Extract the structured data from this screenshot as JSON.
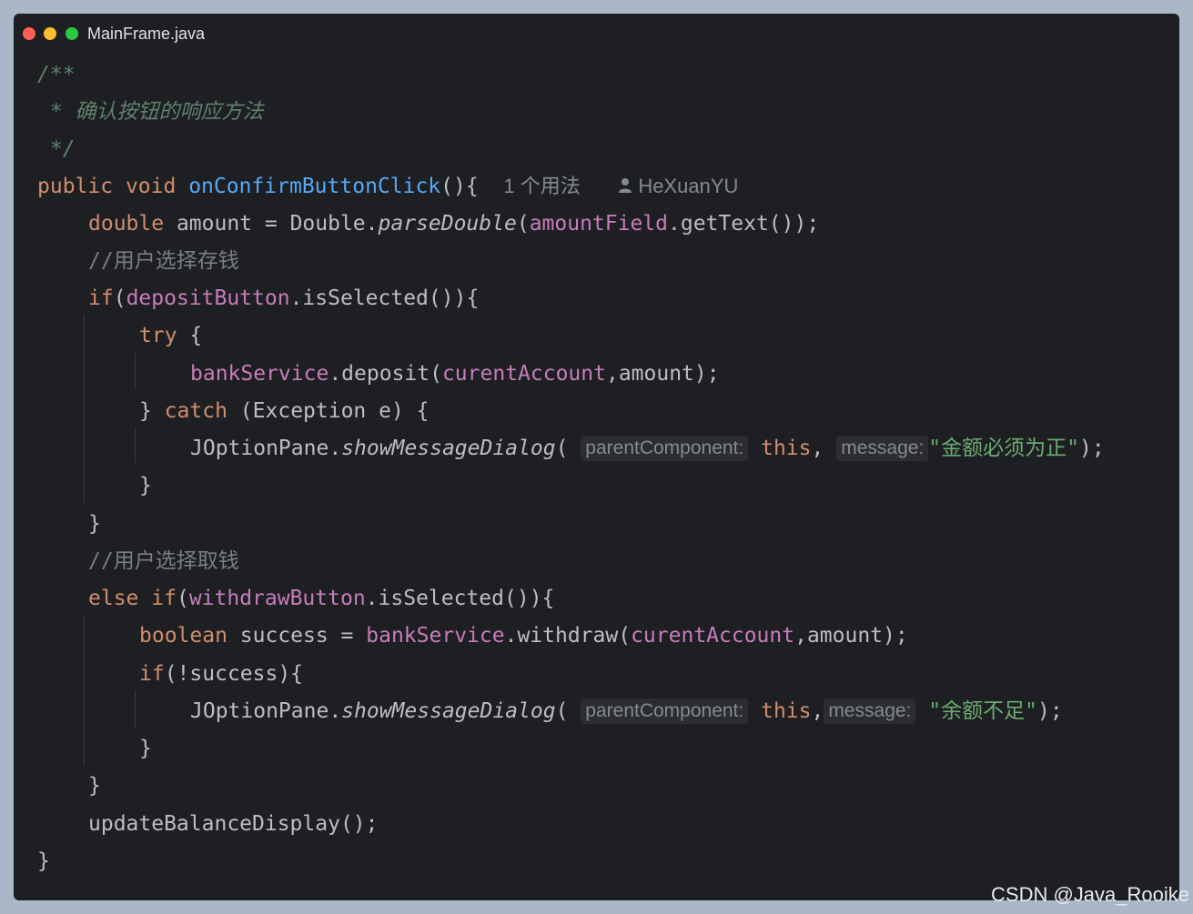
{
  "window": {
    "filename": "MainFrame.java"
  },
  "code": {
    "doc_open": "/**",
    "doc_line": " * 确认按钮的响应方法",
    "doc_close": " */",
    "m_public": "public",
    "m_void": "void",
    "m_name": "onConfirmButtonClick",
    "m_parens": "(){",
    "m_usages": "1 个用法",
    "m_author": "HeXuanYU",
    "l2_type": "double",
    "l2_var": " amount = Double.",
    "l2_call": "parseDouble",
    "l2_paren": "(",
    "l2_field": "amountField",
    "l2_rest": ".getText());",
    "c1": "//用户选择存钱",
    "l4_if": "if",
    "l4_paren": "(",
    "l4_field": "depositButton",
    "l4_rest": ".isSelected()){",
    "l5_try": "try",
    "l5_rest": " {",
    "l6_field": "bankService",
    "l6_call": ".deposit(",
    "l6_field2": "curentAccount",
    "l6_rest": ",amount);",
    "l7_open": "} ",
    "l7_catch": "catch",
    "l7_rest": " (Exception e) {",
    "l8_cls": "JOptionPane.",
    "l8_call": "showMessageDialog",
    "l8_paren": "(",
    "l8_hint1": "parentComponent:",
    "l8_this": "this",
    "l8_comma": ",",
    "l8_hint2": "message:",
    "l8_str": "\"金额必须为正\"",
    "l8_end": ");",
    "l9": "}",
    "l10": "}",
    "c2": "//用户选择取钱",
    "l12_else": "else",
    "l12_if": "if",
    "l12_paren": "(",
    "l12_field": "withdrawButton",
    "l12_rest": ".isSelected()){",
    "l13_type": "boolean",
    "l13_var": " success = ",
    "l13_field": "bankService",
    "l13_call": ".withdraw(",
    "l13_field2": "curentAccount",
    "l13_rest": ",amount);",
    "l14_if": "if",
    "l14_rest": "(!success){",
    "l15_cls": "JOptionPane.",
    "l15_call": "showMessageDialog",
    "l15_paren": "(",
    "l15_hint1": "parentComponent:",
    "l15_this": "this",
    "l15_comma": ",",
    "l15_hint2": "message:",
    "l15_str": "\"余额不足\"",
    "l15_end": ");",
    "l16": "}",
    "l17": "}",
    "l18": "updateBalanceDisplay();",
    "l19": "}"
  },
  "watermark": "CSDN @Java_Rooike",
  "colors": {
    "background": "#1e1f22",
    "keyword": "#cf8e6d",
    "function": "#56a8f5",
    "field": "#c77dbb",
    "string": "#6aab73",
    "comment": "#7a7e85",
    "doc": "#5f826b"
  },
  "icons": [
    "close-dot",
    "minimize-dot",
    "maximize-dot",
    "user-icon"
  ]
}
